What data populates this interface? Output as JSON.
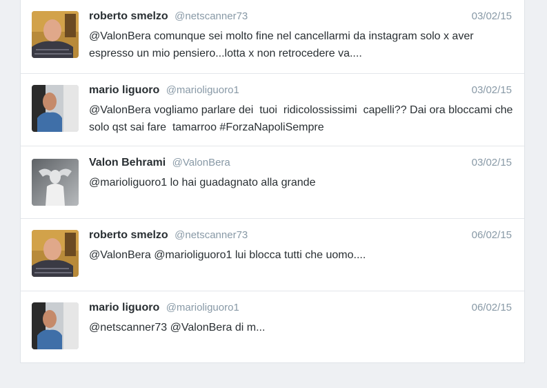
{
  "tweets": [
    {
      "fullname": "roberto smelzo",
      "username": "@netscanner73",
      "date": "03/02/15",
      "text": "@ValonBera comunque sei molto fine nel cancellarmi da instagram solo x aver espresso un mio pensiero...lotta x non retrocedere va....",
      "avatar": "person-photo-roberto"
    },
    {
      "fullname": "mario liguoro",
      "username": "@marioliguoro1",
      "date": "03/02/15",
      "text": "@ValonBera vogliamo parlare dei  tuoi  ridicolossissimi  capelli?? Dai ora bloccami che solo qst sai fare  tamarroo #ForzaNapoliSempre",
      "avatar": "person-photo-mario"
    },
    {
      "fullname": "Valon Behrami",
      "username": "@ValonBera",
      "date": "03/02/15",
      "text": "@marioliguoro1 lo hai guadagnato alla grande",
      "avatar": "person-photo-valon"
    },
    {
      "fullname": "roberto smelzo",
      "username": "@netscanner73",
      "date": "06/02/15",
      "text": "@ValonBera @marioliguoro1 lui blocca tutti che uomo....",
      "avatar": "person-photo-roberto"
    },
    {
      "fullname": "mario liguoro",
      "username": "@marioliguoro1",
      "date": "06/02/15",
      "text": "@netscanner73 @ValonBera di m...",
      "avatar": "person-photo-mario"
    }
  ]
}
